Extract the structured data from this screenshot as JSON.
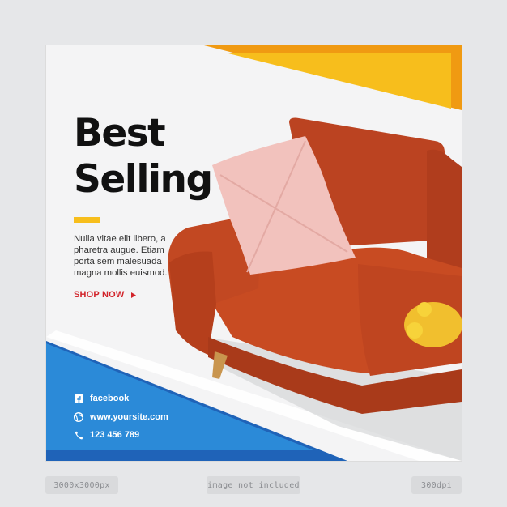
{
  "headline": {
    "line1": "Best",
    "line2": "Selling"
  },
  "body_text": "Nulla vitae elit libero, a pharetra augue. Etiam porta sem malesuada magna mollis euismod.",
  "cta": {
    "label": "SHOP NOW",
    "icon": "triangle-right-icon"
  },
  "contacts": [
    {
      "icon": "facebook-icon",
      "text": "facebook"
    },
    {
      "icon": "globe-icon",
      "text": "www.yoursite.com"
    },
    {
      "icon": "phone-icon",
      "text": "123 456 789"
    }
  ],
  "footer": {
    "size": "3000x3000px",
    "note": "image not included",
    "dpi": "300dpi"
  },
  "colors": {
    "yellow": "#f7be1c",
    "orange": "#f09a12",
    "blue": "#2b8ad8",
    "blue_dark": "#1f63b8",
    "sofa": "#c64a22",
    "cta": "#d2232a"
  }
}
